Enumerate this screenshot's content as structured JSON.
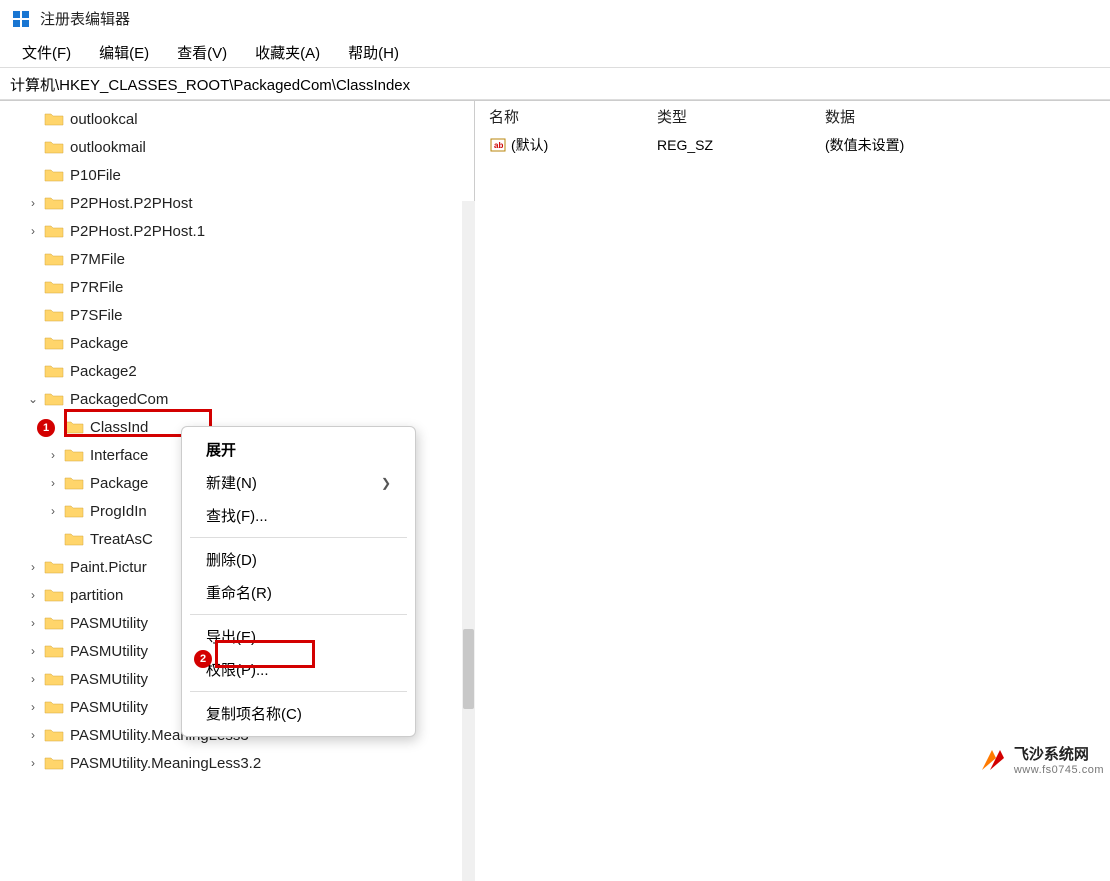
{
  "window": {
    "title": "注册表编辑器"
  },
  "menubar": {
    "file": "文件(F)",
    "edit": "编辑(E)",
    "view": "查看(V)",
    "favorites": "收藏夹(A)",
    "help": "帮助(H)"
  },
  "addressbar": {
    "path": "计算机\\HKEY_CLASSES_ROOT\\PackagedCom\\ClassIndex"
  },
  "tree": {
    "items": [
      {
        "label": "outlookcal",
        "expandable": false,
        "level": 0
      },
      {
        "label": "outlookmail",
        "expandable": false,
        "level": 0
      },
      {
        "label": "P10File",
        "expandable": false,
        "level": 0
      },
      {
        "label": "P2PHost.P2PHost",
        "expandable": true,
        "level": 0
      },
      {
        "label": "P2PHost.P2PHost.1",
        "expandable": true,
        "level": 0
      },
      {
        "label": "P7MFile",
        "expandable": false,
        "level": 0
      },
      {
        "label": "P7RFile",
        "expandable": false,
        "level": 0
      },
      {
        "label": "P7SFile",
        "expandable": false,
        "level": 0
      },
      {
        "label": "Package",
        "expandable": false,
        "level": 0
      },
      {
        "label": "Package2",
        "expandable": false,
        "level": 0
      },
      {
        "label": "PackagedCom",
        "expandable": true,
        "expanded": true,
        "level": 0
      },
      {
        "label": "ClassInd",
        "expandable": true,
        "level": 1,
        "selected": true
      },
      {
        "label": "Interface",
        "expandable": true,
        "level": 1
      },
      {
        "label": "Package",
        "expandable": true,
        "level": 1
      },
      {
        "label": "ProgIdIn",
        "expandable": true,
        "level": 1
      },
      {
        "label": "TreatAsC",
        "expandable": false,
        "level": 1
      },
      {
        "label": "Paint.Pictur",
        "expandable": true,
        "level": 0
      },
      {
        "label": "partition",
        "expandable": true,
        "level": 0
      },
      {
        "label": "PASMUtility",
        "expandable": true,
        "level": 0
      },
      {
        "label": "PASMUtility",
        "expandable": true,
        "level": 0
      },
      {
        "label": "PASMUtility",
        "expandable": true,
        "level": 0
      },
      {
        "label": "PASMUtility",
        "expandable": true,
        "level": 0
      },
      {
        "label": "PASMUtility.MeaningLess3",
        "expandable": true,
        "level": 0
      },
      {
        "label": "PASMUtility.MeaningLess3.2",
        "expandable": true,
        "level": 0
      }
    ]
  },
  "context_menu": {
    "expand": "展开",
    "new": "新建(N)",
    "find": "查找(F)...",
    "delete": "删除(D)",
    "rename": "重命名(R)",
    "export": "导出(E)",
    "permissions": "权限(P)...",
    "copy_key_name": "复制项名称(C)"
  },
  "values": {
    "columns": {
      "name": "名称",
      "type": "类型",
      "data": "数据"
    },
    "rows": [
      {
        "name": "(默认)",
        "type": "REG_SZ",
        "data": "(数值未设置)"
      }
    ]
  },
  "badges": {
    "first": "1",
    "second": "2"
  },
  "watermark": {
    "title": "飞沙系统网",
    "sub": "www.fs0745.com"
  }
}
